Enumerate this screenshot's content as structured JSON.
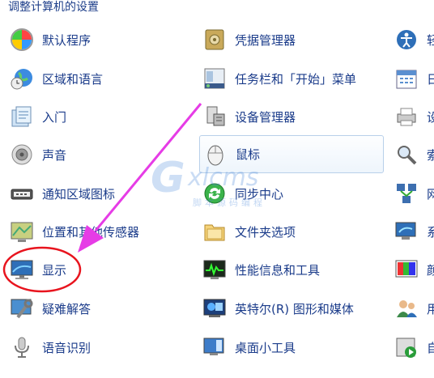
{
  "page": {
    "title": "调整计算机的设置"
  },
  "col1": [
    {
      "label": "默认程序",
      "icon": "default-programs-icon"
    },
    {
      "label": "区域和语言",
      "icon": "globe-clock-icon"
    },
    {
      "label": "入门",
      "icon": "getting-started-icon"
    },
    {
      "label": "声音",
      "icon": "speaker-icon"
    },
    {
      "label": "通知区域图标",
      "icon": "notification-area-icon"
    },
    {
      "label": "位置和其他传感器",
      "icon": "location-sensor-icon"
    },
    {
      "label": "显示",
      "icon": "display-icon"
    },
    {
      "label": "疑难解答",
      "icon": "troubleshooting-icon"
    },
    {
      "label": "语音识别",
      "icon": "microphone-icon"
    }
  ],
  "col2": [
    {
      "label": "凭据管理器",
      "icon": "credential-manager-icon"
    },
    {
      "label": "任务栏和「开始」菜单",
      "icon": "taskbar-start-menu-icon"
    },
    {
      "label": "设备管理器",
      "icon": "device-manager-icon"
    },
    {
      "label": "鼠标",
      "icon": "mouse-icon"
    },
    {
      "label": "同步中心",
      "icon": "sync-center-icon"
    },
    {
      "label": "文件夹选项",
      "icon": "folder-options-icon"
    },
    {
      "label": "性能信息和工具",
      "icon": "performance-icon"
    },
    {
      "label": "英特尔(R) 图形和媒体",
      "icon": "intel-graphics-icon"
    },
    {
      "label": "桌面小工具",
      "icon": "desktop-gadgets-icon"
    }
  ],
  "col3": [
    {
      "label": "轻",
      "icon": "ease-of-access-icon"
    },
    {
      "label": "日",
      "icon": "calendar-icon"
    },
    {
      "label": "设",
      "icon": "devices-printers-icon"
    },
    {
      "label": "索",
      "icon": "indexing-icon"
    },
    {
      "label": "网",
      "icon": "network-sharing-icon"
    },
    {
      "label": "系",
      "icon": "system-icon"
    },
    {
      "label": "颜",
      "icon": "color-management-icon"
    },
    {
      "label": "用",
      "icon": "user-accounts-icon"
    },
    {
      "label": "自",
      "icon": "autoplay-icon"
    }
  ],
  "watermark": {
    "brand": "xlcms",
    "sub": "脚本源码编程"
  },
  "colors": {
    "link": "#1a3b8a",
    "highlight": "#e8141e",
    "arrow": "#e63ce6"
  }
}
